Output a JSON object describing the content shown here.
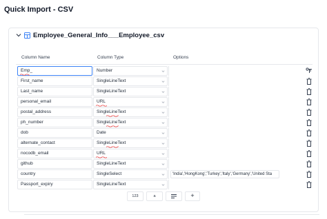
{
  "window": {
    "title": "Quick Import - CSV"
  },
  "panel": {
    "title": "Employee_General_Info___Employee_csv"
  },
  "columns": {
    "name": "Column Name",
    "type": "Column Type",
    "options": "Options"
  },
  "rows": [
    {
      "name": "Emp_",
      "type": "Number",
      "options": "",
      "action": "key-icon"
    },
    {
      "name": "First_name",
      "type": "SingleLineText",
      "options": "",
      "action": "trash-icon"
    },
    {
      "name": "Last_name",
      "type": "SingleLineText",
      "options": "",
      "action": "trash-icon"
    },
    {
      "name": "personal_email",
      "type": "URL",
      "options": "",
      "action": "trash-icon"
    },
    {
      "name": "postal_address",
      "type": "SingleLineText",
      "options": "",
      "action": "trash-icon"
    },
    {
      "name": "ph_number",
      "type": "SingleLineText",
      "options": "",
      "action": "trash-icon"
    },
    {
      "name": "dob",
      "type": "Date",
      "options": "",
      "action": "trash-icon"
    },
    {
      "name": "alternate_contact",
      "type": "SingleLineText",
      "options": "",
      "action": "trash-icon"
    },
    {
      "name": "nocodb_email",
      "type": "URL",
      "options": "",
      "action": "trash-icon"
    },
    {
      "name": "github",
      "type": "SingleLineText",
      "options": "",
      "action": "trash-icon"
    },
    {
      "name": "country",
      "type": "SingleSelect",
      "options": "'India','HongKong','Turkey','Italy','Germany','United Sta",
      "action": "trash-icon"
    },
    {
      "name": "Passport_expiry",
      "type": "SingleLineText",
      "options": "",
      "action": "trash-icon"
    }
  ],
  "toolbar": {
    "number_label": "123",
    "text_label": "a",
    "list_icon": "list-icon",
    "add_label": "+"
  },
  "colors": {
    "accent": "#3b82f6",
    "spellcheck": "#ef4444",
    "border": "#e5e7eb"
  }
}
